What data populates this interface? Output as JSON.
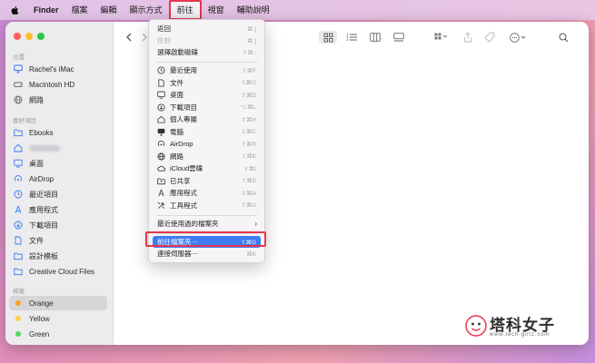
{
  "menubar": {
    "app_name": "Finder",
    "items": [
      "檔案",
      "編輯",
      "顯示方式",
      "前往",
      "視窗",
      "輔助說明"
    ],
    "active_item": "前往"
  },
  "sidebar": {
    "sections": {
      "locations": "位置",
      "favorites": "喜好項目",
      "tags": "標籤"
    },
    "locations": [
      {
        "label": "Rachel's iMac",
        "icon": "imac-icon"
      },
      {
        "label": "Macintosh HD",
        "icon": "hard-drive-icon"
      },
      {
        "label": "網路",
        "icon": "network-globe-icon"
      }
    ],
    "favorites": [
      {
        "label": "Ebooks",
        "icon": "folder-icon"
      },
      {
        "label": "",
        "icon": "home-icon"
      },
      {
        "label": "桌面",
        "icon": "desktop-icon"
      },
      {
        "label": "AirDrop",
        "icon": "airdrop-icon"
      },
      {
        "label": "最近項目",
        "icon": "clock-icon"
      },
      {
        "label": "應用程式",
        "icon": "applications-icon"
      },
      {
        "label": "下載項目",
        "icon": "download-icon"
      },
      {
        "label": "文件",
        "icon": "document-icon"
      },
      {
        "label": "設計模板",
        "icon": "folder-icon"
      },
      {
        "label": "Creative Cloud Files",
        "icon": "folder-icon"
      }
    ],
    "tags": [
      {
        "label": "Orange",
        "color": "#f5a623"
      },
      {
        "label": "Yellow",
        "color": "#f7d23e"
      },
      {
        "label": "Green",
        "color": "#4cd964"
      }
    ]
  },
  "go_menu": {
    "items": [
      {
        "label": "返回",
        "shortcut": "⌘ [",
        "disabled": false
      },
      {
        "label": "往前",
        "shortcut": "⌘ ]",
        "disabled": true
      },
      {
        "label": "選擇啟動磁碟",
        "shortcut": "⇧⌘↑",
        "disabled": false
      },
      {
        "label": "最近使用",
        "shortcut": "⇧⌘F",
        "icon": "clock-icon"
      },
      {
        "label": "文件",
        "shortcut": "⇧⌘O",
        "icon": "document-icon"
      },
      {
        "label": "桌面",
        "shortcut": "⇧⌘D",
        "icon": "desktop-icon"
      },
      {
        "label": "下載項目",
        "shortcut": "⌥⌘L",
        "icon": "download-icon"
      },
      {
        "label": "個人專屬",
        "shortcut": "⇧⌘H",
        "icon": "home-icon"
      },
      {
        "label": "電腦",
        "shortcut": "⇧⌘C",
        "icon": "computer-icon"
      },
      {
        "label": "AirDrop",
        "shortcut": "⇧⌘R",
        "icon": "airdrop-icon"
      },
      {
        "label": "網路",
        "shortcut": "⇧⌘K",
        "icon": "network-globe-icon"
      },
      {
        "label": "iCloud雲碟",
        "shortcut": "⇧⌘I",
        "icon": "cloud-icon"
      },
      {
        "label": "已共享",
        "shortcut": "⇧⌘S",
        "icon": "shared-folder-icon"
      },
      {
        "label": "應用程式",
        "shortcut": "⇧⌘A",
        "icon": "applications-icon"
      },
      {
        "label": "工具程式",
        "shortcut": "⇧⌘U",
        "icon": "utilities-icon"
      }
    ],
    "recent_folders": "最近使用過的檔案夾",
    "go_to_folder": {
      "label": "前往檔案夾⋯",
      "shortcut": "⇧⌘G"
    },
    "connect_server": {
      "label": "連接伺服器⋯",
      "shortcut": "⌘K"
    }
  },
  "watermark": {
    "title": "塔科女子",
    "url": "www.tech-girlz.com"
  },
  "colors": {
    "highlight": "#3d7cf3",
    "callout": "#e8354d"
  }
}
